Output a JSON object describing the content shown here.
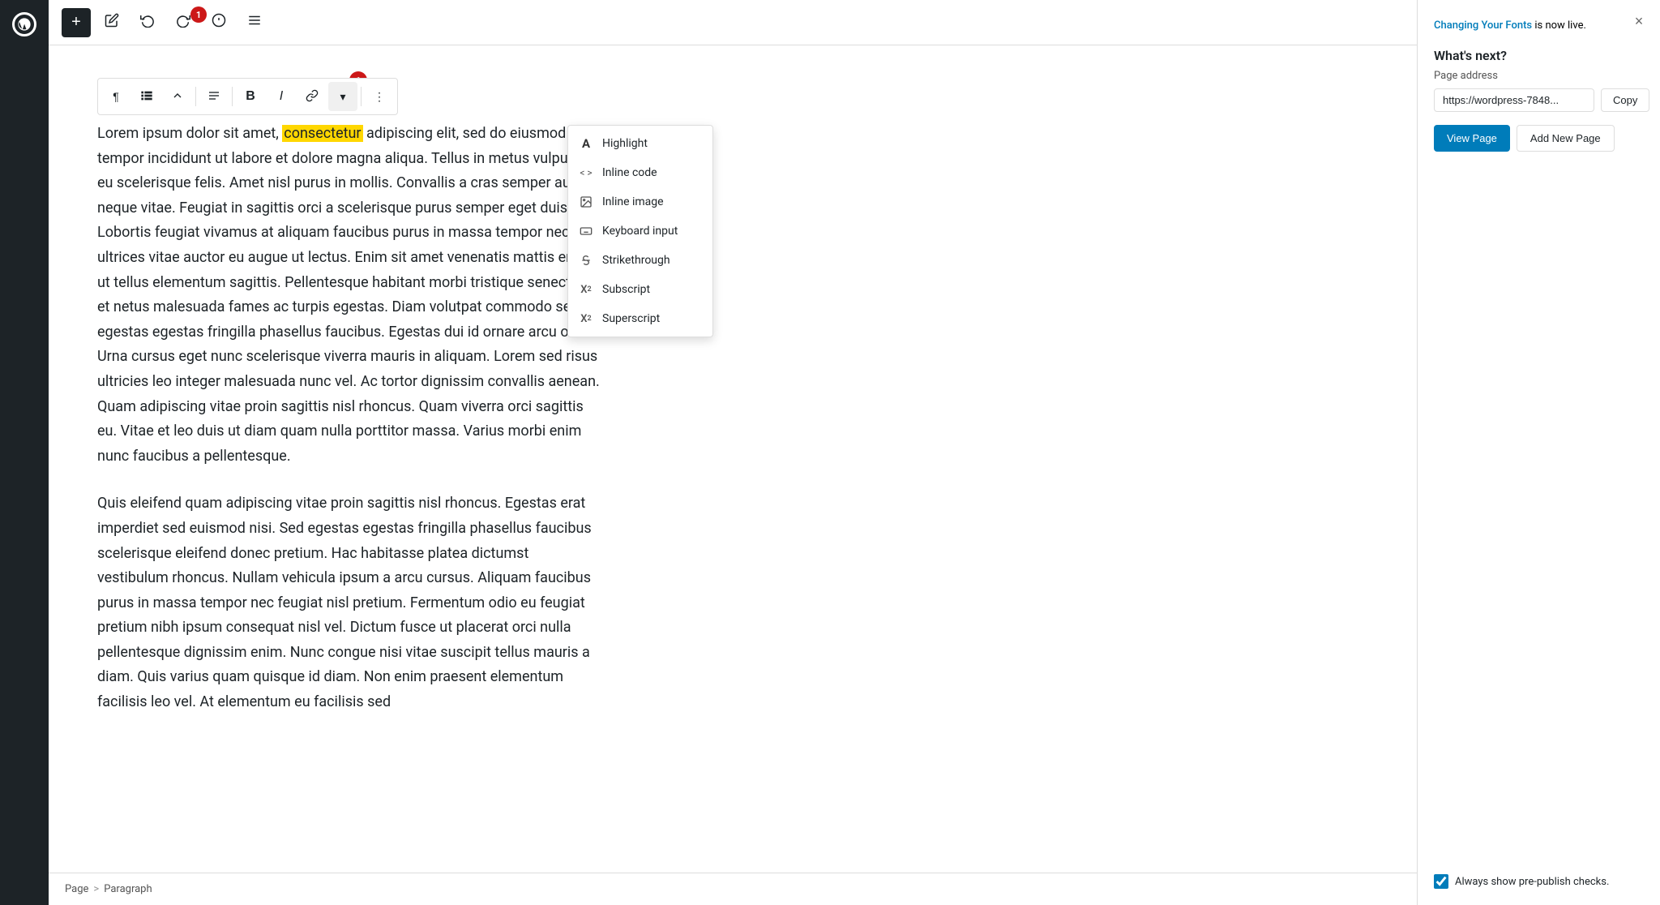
{
  "adminBar": {
    "logo": "W"
  },
  "topToolbar": {
    "addBlockLabel": "+",
    "editLabel": "✎",
    "undoLabel": "↺",
    "redoLabel": "↻",
    "infoLabel": "ℹ",
    "listViewLabel": "☰"
  },
  "badge": {
    "count": "1"
  },
  "blockToolbar": {
    "paragraphIcon": "¶",
    "listIcon": "⁞⁞",
    "arrowsIcon": "⇕",
    "alignIcon": "≡",
    "boldLabel": "B",
    "italicLabel": "I",
    "linkLabel": "🔗",
    "dropdownLabel": "▾",
    "moreLabel": "⋮"
  },
  "dropdown": {
    "items": [
      {
        "id": "highlight",
        "icon": "A",
        "label": "Highlight",
        "iconType": "highlight"
      },
      {
        "id": "inline-code",
        "icon": "<>",
        "label": "Inline code",
        "iconType": "code"
      },
      {
        "id": "inline-image",
        "icon": "⊡",
        "label": "Inline image",
        "iconType": "image"
      },
      {
        "id": "keyboard-input",
        "icon": "⌨",
        "label": "Keyboard input",
        "iconType": "keyboard"
      },
      {
        "id": "strikethrough",
        "icon": "S̶",
        "label": "Strikethrough",
        "iconType": "strikethrough"
      },
      {
        "id": "subscript",
        "icon": "X₂",
        "label": "Subscript",
        "iconType": "subscript"
      },
      {
        "id": "superscript",
        "icon": "X²",
        "label": "Superscript",
        "iconType": "superscript"
      }
    ]
  },
  "paragraphs": [
    {
      "id": "p1",
      "text": "Lorem ipsum dolor sit amet, consectetur adipiscing elit, sed do eiusmod tempor incididunt ut labore et dolore magna aliqua. Tellus in metus vulputate eu scelerisque felis. Amet nisl purus in mollis. Convallis a cras semper auctor neque vitae. Feugiat in sagittis orci a scelerisque purus semper eget duis. Lobortis feugiat vivamus at aliquam faucibus purus in massa tempor nec. Eu ultrices vitae auctor eu augue ut lectus. Enim sit amet venenatis mattis enim ut tellus elementum sagittis. Pellentesque habitant morbi tristique senectus et netus malesuada fames ac turpis egestas. Diam volutpat commodo sed egestas egestas fringilla phasellus faucibus. Egestas dui id ornare arcu odio. Urna cursus eget nunc scelerisque viverra mauris in aliquam. Lorem sed risus ultricies leo integer malesuada nunc vel. Ac tortor dignissim convallis aenean. Quam adipiscing vitae proin sagittis nisl rhoncus. Quam viverra orci sagittis eu. Vitae et leo duis ut diam quam nulla porttitor massa. Varius morbi enim nunc faucibus a pellentesque."
    },
    {
      "id": "p2",
      "text": "Quis eleifend quam adipiscing vitae proin sagittis nisl rhoncus. Egestas erat imperdiet sed euismod nisi. Sed egestas egestas fringilla phasellus faucibus scelerisque eleifend donec pretium. Hac habitasse platea dictumst vestibulum rhoncus. Nullam vehicula ipsum a arcu cursus. Aliquam faucibus purus in massa tempor nec feugiat nisl pretium. Fermentum odio eu feugiat pretium nibh ipsum consequat nisl vel. Dictum fusce ut placerat orci nulla pellentesque dignissim enim. Nunc congue nisi vitae suscipit tellus mauris a diam. Quis varius quam quisque id diam. Non enim praesent elementum facilisis leo vel. At elementum eu facilisis sed"
    }
  ],
  "rightPanel": {
    "notification": "Changing Your Fonts is now live.",
    "notificationLink": "Changing Your Fonts",
    "whatsNextTitle": "What's next?",
    "pageAddressLabel": "Page address",
    "pageAddressValue": "https://wordpress-7848...",
    "copyLabel": "Copy",
    "viewPageLabel": "View Page",
    "addNewPageLabel": "Add New Page",
    "prePublishLabel": "Always show pre-publish checks.",
    "closeIcon": "×"
  },
  "breadcrumb": {
    "items": [
      "Page",
      ">",
      "Paragraph"
    ]
  }
}
